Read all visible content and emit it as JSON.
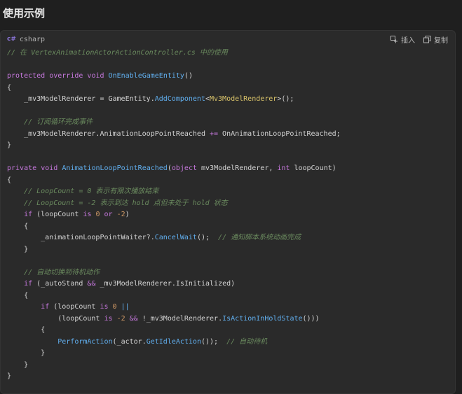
{
  "page": {
    "title": "使用示例"
  },
  "code_block": {
    "language": "csharp",
    "language_icon": "c#",
    "insert_label": "插入",
    "copy_label": "复制",
    "lines": [
      [
        {
          "t": "// 在 VertexAnimationActorActionController.cs 中的使用",
          "c": "cm"
        }
      ],
      [],
      [
        {
          "t": "protected",
          "c": "kw"
        },
        {
          "t": " ",
          "c": "plain"
        },
        {
          "t": "override",
          "c": "kw"
        },
        {
          "t": " ",
          "c": "plain"
        },
        {
          "t": "void",
          "c": "kw"
        },
        {
          "t": " ",
          "c": "plain"
        },
        {
          "t": "OnEnableGameEntity",
          "c": "fn"
        },
        {
          "t": "()",
          "c": "plain"
        }
      ],
      [
        {
          "t": "{",
          "c": "plain"
        }
      ],
      [
        {
          "t": "    _mv3ModelRenderer = GameEntity.",
          "c": "plain"
        },
        {
          "t": "AddComponent",
          "c": "fn"
        },
        {
          "t": "<",
          "c": "plain"
        },
        {
          "t": "Mv3ModelRenderer",
          "c": "ty"
        },
        {
          "t": ">();",
          "c": "plain"
        }
      ],
      [],
      [
        {
          "t": "    // 订阅循环完成事件",
          "c": "cm"
        }
      ],
      [
        {
          "t": "    _mv3ModelRenderer.AnimationLoopPointReached ",
          "c": "plain"
        },
        {
          "t": "+=",
          "c": "kw"
        },
        {
          "t": " OnAnimationLoopPointReached;",
          "c": "plain"
        }
      ],
      [
        {
          "t": "}",
          "c": "plain"
        }
      ],
      [],
      [
        {
          "t": "private",
          "c": "kw"
        },
        {
          "t": " ",
          "c": "plain"
        },
        {
          "t": "void",
          "c": "kw"
        },
        {
          "t": " ",
          "c": "plain"
        },
        {
          "t": "AnimationLoopPointReached",
          "c": "fn"
        },
        {
          "t": "(",
          "c": "plain"
        },
        {
          "t": "object",
          "c": "kw"
        },
        {
          "t": " mv3ModelRenderer, ",
          "c": "plain"
        },
        {
          "t": "int",
          "c": "kw"
        },
        {
          "t": " loopCount)",
          "c": "plain"
        }
      ],
      [
        {
          "t": "{",
          "c": "plain"
        }
      ],
      [
        {
          "t": "    // LoopCount = 0 表示有限次播放结束",
          "c": "cm"
        }
      ],
      [
        {
          "t": "    // LoopCount = -2 表示到达 hold 点但未处于 hold 状态",
          "c": "cm"
        }
      ],
      [
        {
          "t": "    ",
          "c": "plain"
        },
        {
          "t": "if",
          "c": "kw"
        },
        {
          "t": " (loopCount ",
          "c": "plain"
        },
        {
          "t": "is",
          "c": "kw"
        },
        {
          "t": " ",
          "c": "plain"
        },
        {
          "t": "0",
          "c": "num"
        },
        {
          "t": " ",
          "c": "plain"
        },
        {
          "t": "or",
          "c": "kw"
        },
        {
          "t": " ",
          "c": "plain"
        },
        {
          "t": "-2",
          "c": "num"
        },
        {
          "t": ")",
          "c": "plain"
        }
      ],
      [
        {
          "t": "    {",
          "c": "plain"
        }
      ],
      [
        {
          "t": "        _animationLoopPointWaiter?.",
          "c": "plain"
        },
        {
          "t": "CancelWait",
          "c": "fn"
        },
        {
          "t": "();  ",
          "c": "plain"
        },
        {
          "t": "// 通知脚本系统动画完成",
          "c": "cm"
        }
      ],
      [
        {
          "t": "    }",
          "c": "plain"
        }
      ],
      [],
      [
        {
          "t": "    // 自动切换到待机动作",
          "c": "cm"
        }
      ],
      [
        {
          "t": "    ",
          "c": "plain"
        },
        {
          "t": "if",
          "c": "kw"
        },
        {
          "t": " (_autoStand ",
          "c": "plain"
        },
        {
          "t": "&&",
          "c": "kw"
        },
        {
          "t": " _mv3ModelRenderer.IsInitialized)",
          "c": "plain"
        }
      ],
      [
        {
          "t": "    {",
          "c": "plain"
        }
      ],
      [
        {
          "t": "        ",
          "c": "plain"
        },
        {
          "t": "if",
          "c": "kw"
        },
        {
          "t": " (loopCount ",
          "c": "plain"
        },
        {
          "t": "is",
          "c": "kw"
        },
        {
          "t": " ",
          "c": "plain"
        },
        {
          "t": "0",
          "c": "num"
        },
        {
          "t": " ",
          "c": "plain"
        },
        {
          "t": "||",
          "c": "fn"
        }
      ],
      [
        {
          "t": "            (loopCount ",
          "c": "plain"
        },
        {
          "t": "is",
          "c": "kw"
        },
        {
          "t": " ",
          "c": "plain"
        },
        {
          "t": "-2",
          "c": "num"
        },
        {
          "t": " ",
          "c": "plain"
        },
        {
          "t": "&&",
          "c": "kw"
        },
        {
          "t": " !_mv3ModelRenderer.",
          "c": "plain"
        },
        {
          "t": "IsActionInHoldState",
          "c": "fn"
        },
        {
          "t": "()))",
          "c": "plain"
        }
      ],
      [
        {
          "t": "        {",
          "c": "plain"
        }
      ],
      [
        {
          "t": "            ",
          "c": "plain"
        },
        {
          "t": "PerformAction",
          "c": "fn"
        },
        {
          "t": "(_actor.",
          "c": "plain"
        },
        {
          "t": "GetIdleAction",
          "c": "fn"
        },
        {
          "t": "());  ",
          "c": "plain"
        },
        {
          "t": "// 自动待机",
          "c": "cm"
        }
      ],
      [
        {
          "t": "        }",
          "c": "plain"
        }
      ],
      [
        {
          "t": "    }",
          "c": "plain"
        }
      ],
      [
        {
          "t": "}",
          "c": "plain"
        }
      ]
    ]
  }
}
